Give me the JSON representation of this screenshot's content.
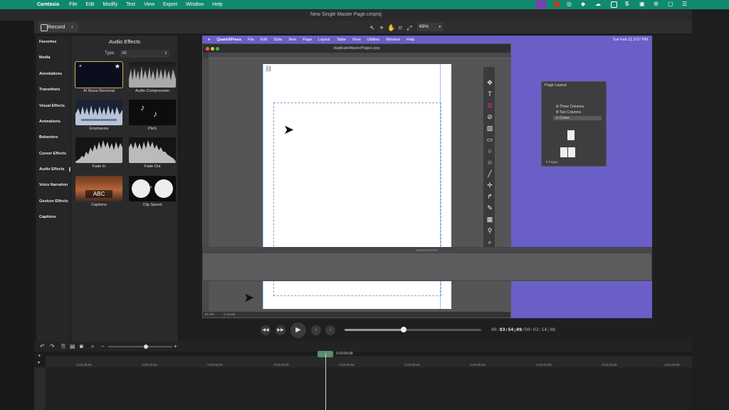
{
  "menubar": {
    "app": "Camtasia",
    "items": [
      "File",
      "Edit",
      "Modify",
      "Text",
      "View",
      "Export",
      "Window",
      "Help"
    ]
  },
  "window": {
    "title": "New Single Master Page.cmproj"
  },
  "toolbar": {
    "record_label": "Record",
    "zoom": "69%"
  },
  "sidenav": {
    "items": [
      "Favorites",
      "Media",
      "Annotations",
      "Transitions",
      "Visual Effects",
      "Animations",
      "Behaviors",
      "Cursor Effects",
      "Audio Effects",
      "Voice Narration",
      "Gesture Effects",
      "Captions"
    ],
    "active": "Audio Effects"
  },
  "effects": {
    "title": "Audio Effects",
    "type_label": "Type:",
    "type_value": "All",
    "tiles": [
      "AI Noise Removal",
      "Audio Compression",
      "Emphasize",
      "Pitch",
      "Fade In",
      "Fade Out",
      "Captions",
      "Clip Speed"
    ],
    "captions_thumb_text": "ABC"
  },
  "quark": {
    "menu": [
      "QuarkXPress",
      "File",
      "Edit",
      "Style",
      "Item",
      "Page",
      "Layout",
      "Table",
      "View",
      "Utilities",
      "Window",
      "Help"
    ],
    "clock": "Tue Feb 11  3:57 PM",
    "doc_title": "duplicateMasterPages.qxp",
    "status_zoom": "67.2%",
    "status_page": "C-Cover",
    "measure_title": "Measurements",
    "page_layout": {
      "title": "Page Layout",
      "items": [
        "A-Three Columns",
        "B-Two Columns",
        "C-Cover"
      ],
      "selected": "C-Cover",
      "footer": "6 Pages"
    }
  },
  "player": {
    "time_current": "03:54;09",
    "time_total": "00:03:54;08",
    "time_prefix": "00:",
    "time_sep": "/",
    "progress": 0.43
  },
  "timeline": {
    "playhead_time": "0:03:54;08",
    "ticks": [
      "0:03:35;00",
      "0:03:40;00",
      "0:03:45;00",
      "0:03:50;00",
      "0:03:55;00",
      "0:04:00;00",
      "0:04:05;00",
      "0:04:10;00",
      "0:04:15;00",
      "0:04:20;00"
    ]
  }
}
